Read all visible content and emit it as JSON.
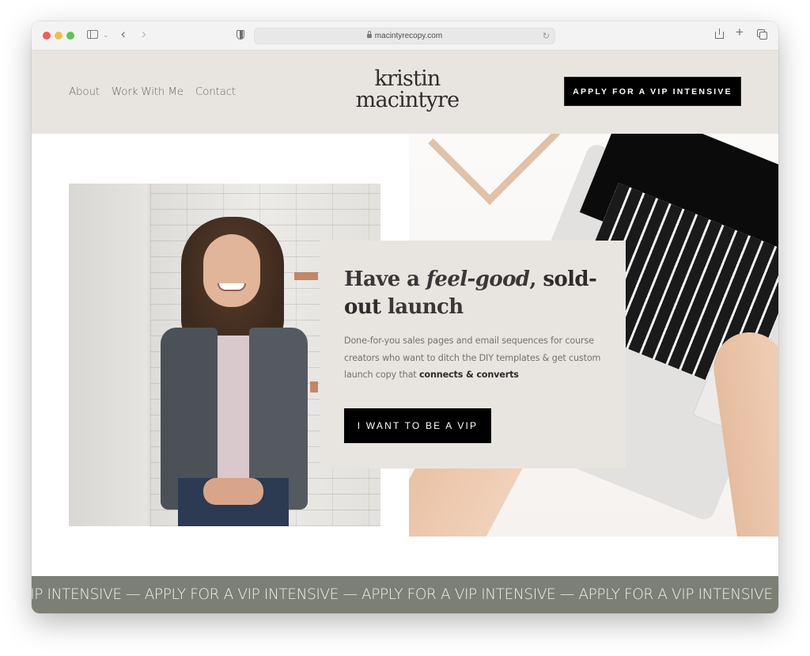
{
  "browser": {
    "url": "macintyrecopy.com",
    "icons": {
      "close": "traffic-red",
      "minimize": "traffic-yellow",
      "zoom": "traffic-green",
      "sidebar": "sidebar-icon",
      "back": "chevron-left-icon",
      "forward": "chevron-right-icon",
      "privacy": "shield-icon",
      "lock": "lock-icon",
      "reload": "reload-icon",
      "share": "share-icon",
      "new_tab": "plus-icon",
      "tab_overview": "tabs-icon"
    },
    "glyphs": {
      "sidebar_chevron": "⌄",
      "back": "‹",
      "forward": "›",
      "reload": "↻",
      "plus": "+"
    }
  },
  "header": {
    "nav": [
      {
        "label": "About"
      },
      {
        "label": "Work With Me"
      },
      {
        "label": "Contact"
      }
    ],
    "logo_line1": "kristin",
    "logo_line2": "macintyre",
    "cta_label": "APPLY FOR A VIP INTENSIVE"
  },
  "hero": {
    "headline": {
      "part1": "Have a ",
      "italic": "feel-good",
      "part2": ", ",
      "bold1": "sold-",
      "bold2": "out",
      "part3": " launch"
    },
    "subtext": {
      "text": "Done-for-you sales pages and email sequences for course creators who want to ditch the DIY templates & get custom launch copy that ",
      "bold": "connects & converts"
    },
    "cta_label": "I WANT TO BE A VIP",
    "images": {
      "left": "portrait-photo-woman-smiling",
      "right": "photo-hands-typing-laptop"
    }
  },
  "marquee": {
    "text": "VIP INTENSIVE — APPLY FOR A VIP INTENSIVE — APPLY FOR A VIP INTENSIVE — APPLY FOR A VIP INTENSIVE"
  },
  "colors": {
    "header_bg": "#e8e5e1",
    "button_bg": "#000000",
    "marquee_bg": "#7c7f73",
    "text_dark": "#3a3837"
  }
}
